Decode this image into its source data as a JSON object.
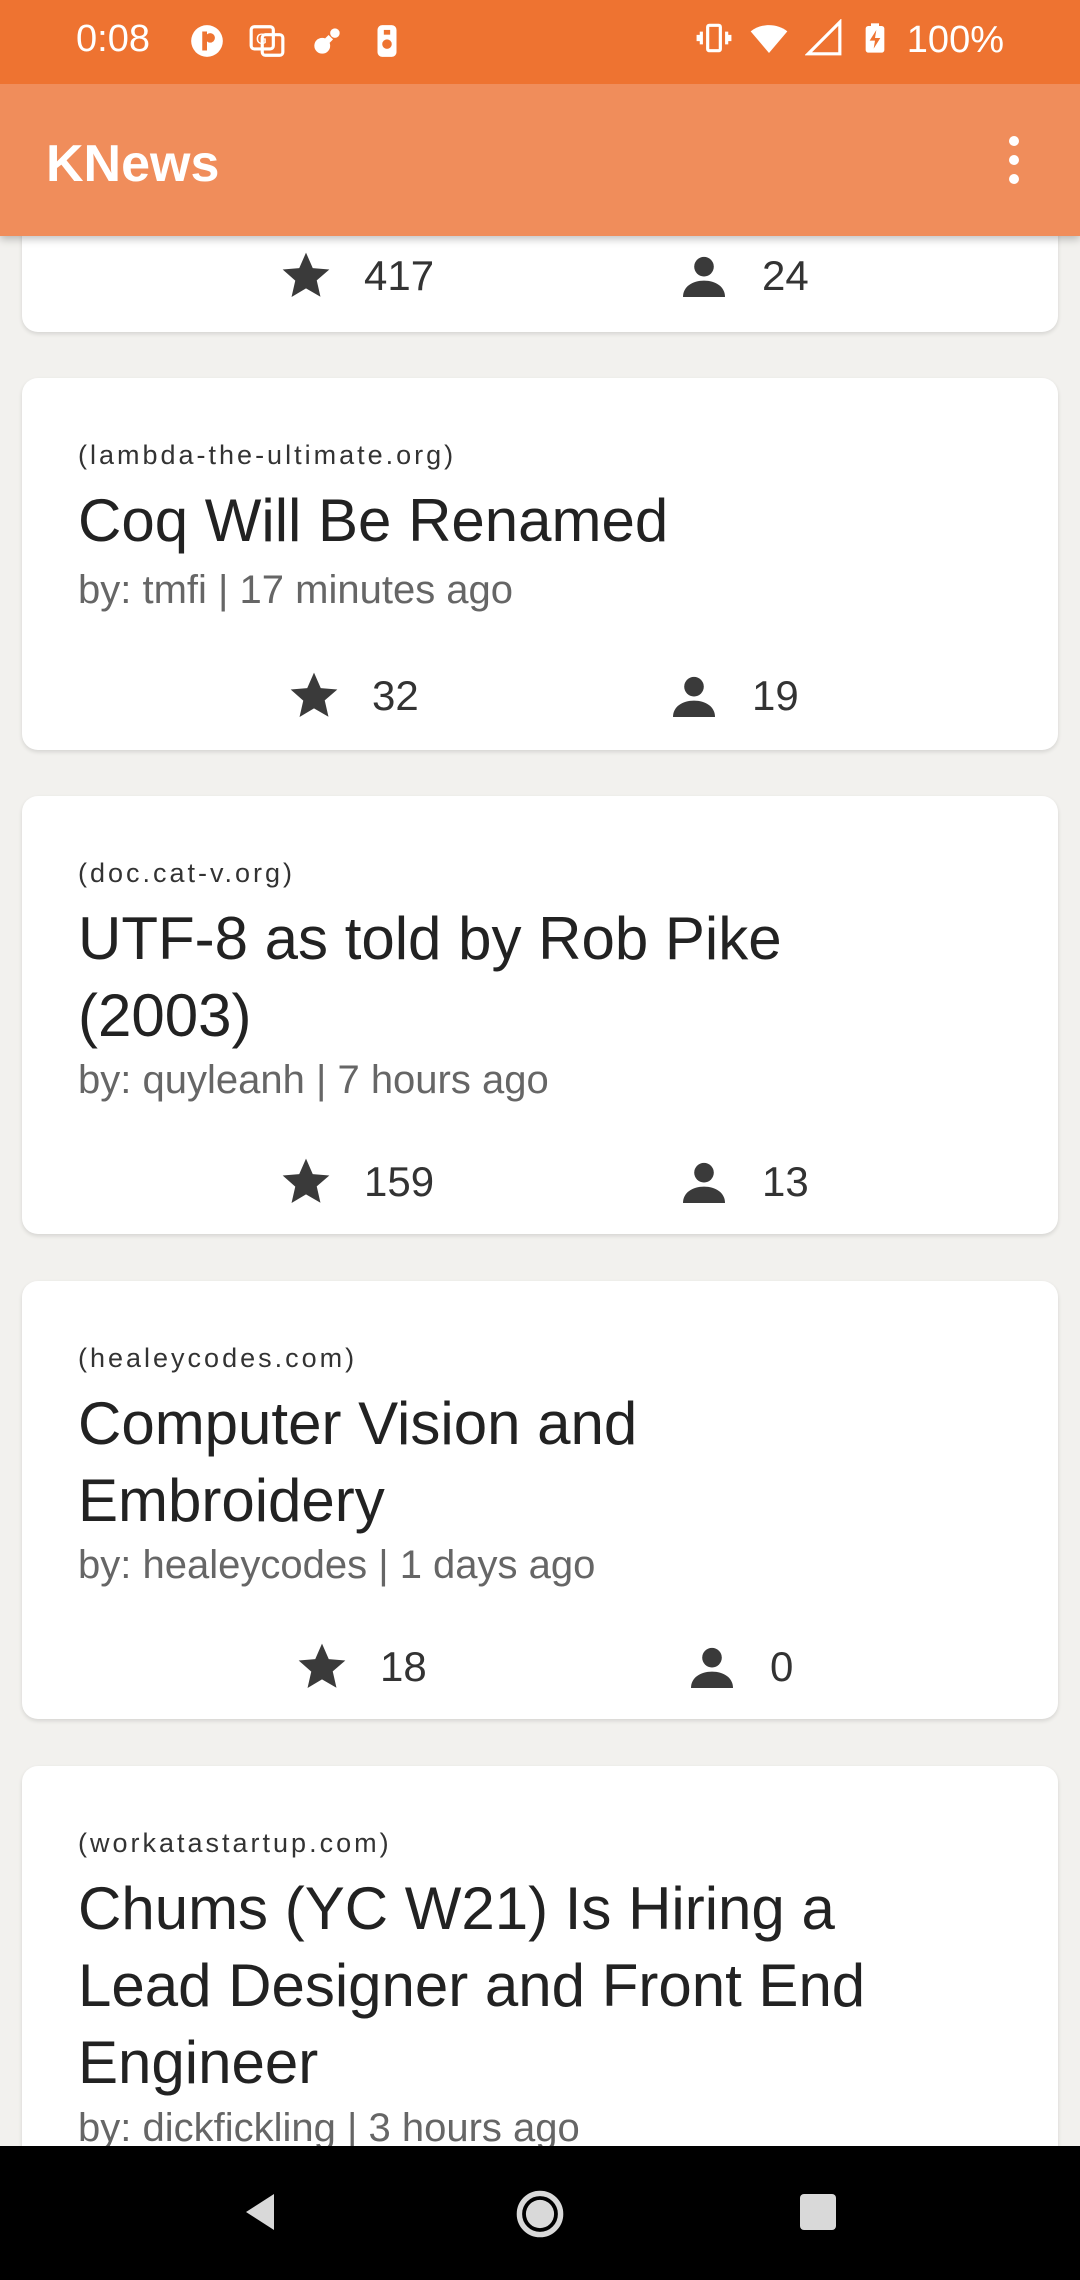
{
  "status_bar": {
    "time": "0:08",
    "battery": "100%",
    "left_icons": [
      "app-icon",
      "translate-icon",
      "bug-icon",
      "sim-icon"
    ],
    "right_icons": [
      "vibrate-icon",
      "wifi-icon",
      "signal-icon",
      "battery-charging-icon"
    ]
  },
  "app_bar": {
    "title": "KNews",
    "menu_icon": "more-vert-icon"
  },
  "partial_card": {
    "points": "417",
    "comments": "24"
  },
  "stories": [
    {
      "source": "(lambda-the-ultimate.org)",
      "title_lines": [
        "Coq Will Be Renamed"
      ],
      "byline": "by: tmfi | 17 minutes ago",
      "points": "32",
      "comments": "19"
    },
    {
      "source": "(doc.cat-v.org)",
      "title_lines": [
        "UTF-8 as told by Rob Pike",
        "(2003)"
      ],
      "byline": "by: quyleanh | 7 hours ago",
      "points": "159",
      "comments": "13"
    },
    {
      "source": "(healeycodes.com)",
      "title_lines": [
        "Computer Vision and",
        "Embroidery"
      ],
      "byline": "by: healeycodes | 1 days ago",
      "points": "18",
      "comments": "0"
    },
    {
      "source": "(workatastartup.com)",
      "title_lines": [
        "Chums (YC W21) Is Hiring a",
        "Lead Designer and Front End",
        "Engineer"
      ],
      "byline": "by: dickfickling | 3 hours ago",
      "points": "",
      "comments": ""
    }
  ],
  "nav_bar": {
    "icons": [
      "back-icon",
      "home-icon",
      "recents-icon"
    ]
  },
  "colors": {
    "status_bar": "#ee7331",
    "app_bar": "#f08d5b",
    "background": "#f2f1ee",
    "card": "#ffffff"
  }
}
